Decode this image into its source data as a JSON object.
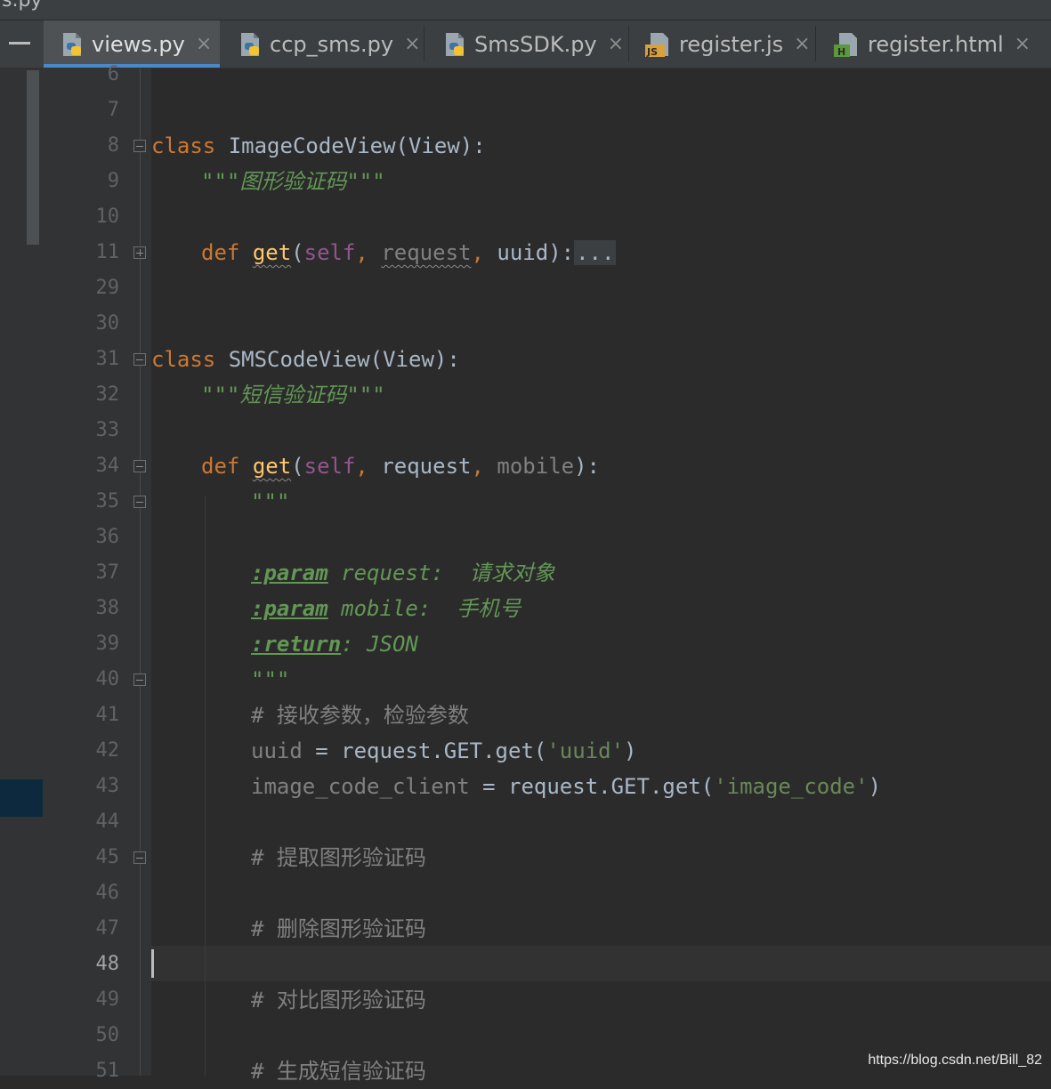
{
  "window": {
    "partial_title": "s.py"
  },
  "tabs": [
    {
      "label": "views.py",
      "icon": "python-file-icon",
      "active": true
    },
    {
      "label": "ccp_sms.py",
      "icon": "python-file-icon",
      "active": false
    },
    {
      "label": "SmsSDK.py",
      "icon": "python-file-icon",
      "active": false
    },
    {
      "label": "register.js",
      "icon": "javascript-file-icon",
      "badge": "JS",
      "active": false
    },
    {
      "label": "register.html",
      "icon": "html-file-icon",
      "badge": "H",
      "active": false
    }
  ],
  "tab_close": "×",
  "line_numbers": [
    "6",
    "7",
    "8",
    "9",
    "10",
    "11",
    "29",
    "30",
    "31",
    "32",
    "33",
    "34",
    "35",
    "36",
    "37",
    "38",
    "39",
    "40",
    "41",
    "42",
    "43",
    "44",
    "45",
    "46",
    "47",
    "48",
    "49",
    "50",
    "51"
  ],
  "current_line": "48",
  "code": {
    "l8_kw": "class",
    "l8_name": " ImageCodeView",
    "l8_rest": "(View):",
    "l9": "\"\"\"图形验证码\"\"\"",
    "l11_kw": "def",
    "l11_fn": "get",
    "l11_open": "(",
    "l11_self": "self",
    "l11_c1": ", ",
    "l11_req": "request",
    "l11_c2": ", ",
    "l11_uuid": "uuid",
    "l11_close": "):",
    "l11_fold": "...",
    "l31_kw": "class",
    "l31_name": " SMSCodeView",
    "l31_rest": "(View):",
    "l32": "\"\"\"短信验证码\"\"\"",
    "l34_kw": "def",
    "l34_fn": "get",
    "l34_open": "(",
    "l34_self": "self",
    "l34_c1": ", ",
    "l34_req": "request",
    "l34_c2": ", ",
    "l34_mob": "mobile",
    "l34_close": "):",
    "l35": "\"\"\"",
    "l37_tag": ":param",
    "l37_rest": " request:  请求对象",
    "l38_tag": ":param",
    "l38_rest": " mobile:  手机号",
    "l39_tag": ":return",
    "l39_rest": ": JSON",
    "l40": "\"\"\"",
    "l41": "# 接收参数，检验参数",
    "l42_var": "uuid",
    "l42_eq": " = ",
    "l42_call": "request.GET.get(",
    "l42_str": "'uuid'",
    "l42_end": ")",
    "l43_var": "image_code_client",
    "l43_eq": " = ",
    "l43_call": "request.GET.get(",
    "l43_str": "'image_code'",
    "l43_end": ")",
    "l45": "# 提取图形验证码",
    "l47": "# 删除图形验证码",
    "l49": "# 对比图形验证码",
    "l51": "# 生成短信验证码"
  },
  "watermark": "https://blog.csdn.net/Bill_82",
  "colors": {
    "keyword": "#cc7832",
    "function": "#ffc66d",
    "docstring": "#629755",
    "string": "#6a8759",
    "comment": "#808080",
    "background": "#2b2b2b",
    "tab_underline": "#4a88c7"
  }
}
